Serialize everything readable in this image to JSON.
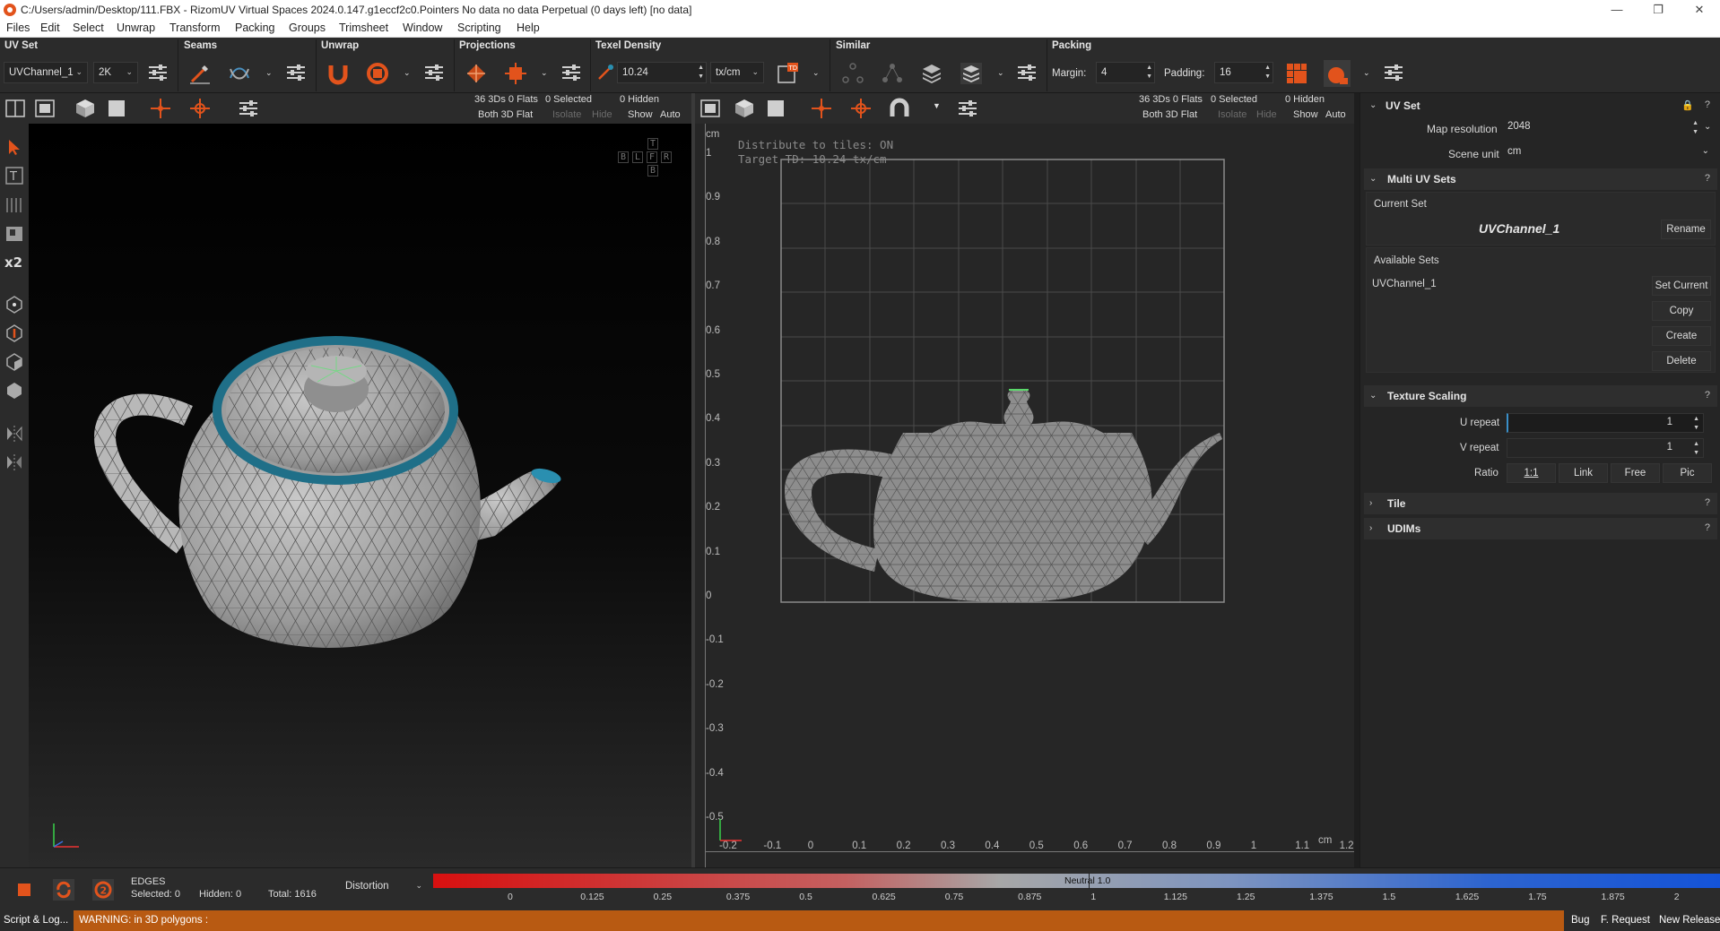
{
  "window": {
    "title": "C:/Users/admin/Desktop/111.FBX - RizomUV  Virtual Spaces 2024.0.147.g1eccf2c0.Pointers No data no data Perpetual  (0 days left) [no data]"
  },
  "menu": [
    "Files",
    "Edit",
    "Select",
    "Unwrap",
    "Transform",
    "Packing",
    "Groups",
    "Trimsheet",
    "Window",
    "Scripting",
    "Help"
  ],
  "toolbar": {
    "uvset": {
      "title": "UV Set",
      "channel": "UVChannel_1",
      "res": "2K"
    },
    "seams": {
      "title": "Seams"
    },
    "unwrap": {
      "title": "Unwrap"
    },
    "projections": {
      "title": "Projections"
    },
    "texel": {
      "title": "Texel Density",
      "value": "10.24",
      "unit": "tx/cm"
    },
    "similar": {
      "title": "Similar"
    },
    "packing": {
      "title": "Packing",
      "margin_label": "Margin:",
      "margin": "4",
      "padding_label": "Padding:",
      "padding": "16"
    }
  },
  "stats3d": {
    "line1a": "36 3Ds 0 Flats",
    "line2a": "Both 3D Flat",
    "line1b": "0 Selected",
    "isolate": "Isolate",
    "hide": "Hide",
    "line1c": "0 Hidden",
    "show": "Show",
    "auto": "Auto"
  },
  "statsuv": {
    "line1a": "36 3Ds 0 Flats",
    "line2a": "Both 3D Flat",
    "line1b": "0 Selected",
    "isolate": "Isolate",
    "hide": "Hide",
    "line1c": "0 Hidden",
    "show": "Show",
    "auto": "Auto"
  },
  "viewcube": {
    "t": "T",
    "b": "B",
    "l": "L",
    "f": "F",
    "r": "R",
    "bottom": "B"
  },
  "uv": {
    "info1": "Distribute to tiles: ON",
    "info2": "Target TD: 10.24 tx/cm",
    "unit_v": "cm",
    "unit_u": "cm",
    "vticks": [
      "1",
      "0.9",
      "0.8",
      "0.7",
      "0.6",
      "0.5",
      "0.4",
      "0.3",
      "0.2",
      "0.1",
      "0",
      "-0.1",
      "-0.2",
      "-0.3",
      "-0.4",
      "-0.5"
    ],
    "uticks": [
      "-0.2",
      "-0.1",
      "0",
      "0.1",
      "0.2",
      "0.3",
      "0.4",
      "0.5",
      "0.6",
      "0.7",
      "0.8",
      "0.9",
      "1",
      "1.1",
      "1.2"
    ]
  },
  "panel": {
    "uvset_title": "UV Set",
    "map_res_label": "Map resolution",
    "map_res": "2048",
    "scene_unit_label": "Scene unit",
    "scene_unit": "cm",
    "multi_title": "Multi UV Sets",
    "current_set_label": "Current Set",
    "current_set": "UVChannel_1",
    "rename": "Rename",
    "available_label": "Available Sets",
    "available_item": "UVChannel_1",
    "set_current": "Set Current",
    "copy": "Copy",
    "create": "Create",
    "delete": "Delete",
    "texture_title": "Texture Scaling",
    "u_repeat_label": "U repeat",
    "u_repeat": "1",
    "v_repeat_label": "V repeat",
    "v_repeat": "1",
    "ratio_label": "Ratio",
    "ratio_11": "1:1",
    "ratio_link": "Link",
    "ratio_free": "Free",
    "ratio_pic": "Pic",
    "tile_title": "Tile",
    "udims_title": "UDIMs",
    "help": "?"
  },
  "bottom": {
    "mode": "EDGES",
    "selected": "Selected: 0",
    "hidden": "Hidden: 0",
    "total": "Total: 1616",
    "display": "Distortion",
    "neutral": "Neutral 1.0",
    "ticks": [
      "0",
      "0.125",
      "0.25",
      "0.375",
      "0.5",
      "0.625",
      "0.75",
      "0.875",
      "1",
      "1.125",
      "1.25",
      "1.375",
      "1.5",
      "1.625",
      "1.75",
      "1.875",
      "2"
    ]
  },
  "status": {
    "script_log": "Script & Log...",
    "warning": "WARNING: in 3D polygons :",
    "bug": "Bug",
    "feature": "F. Request",
    "new_release": "New Release"
  },
  "colors": {
    "accent": "#e2531c",
    "highlight_uv": "#2a8fb0",
    "status_bg": "#b85a12"
  }
}
